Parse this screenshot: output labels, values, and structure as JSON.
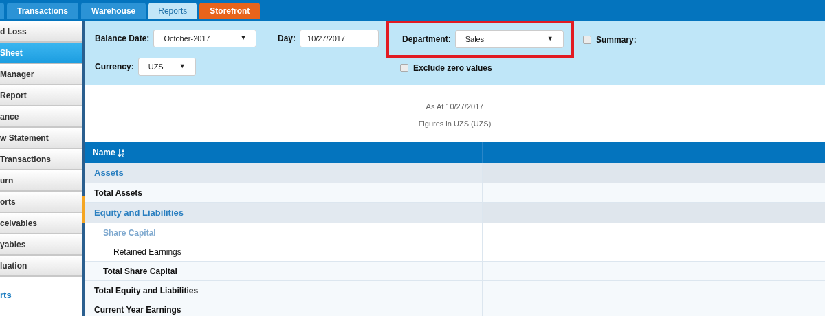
{
  "tabs": [
    {
      "label": "Transactions",
      "kind": "tab",
      "selected": false
    },
    {
      "label": "Warehouse",
      "kind": "tab",
      "selected": false
    },
    {
      "label": "Reports",
      "kind": "tab",
      "selected": true
    },
    {
      "label": "Storefront",
      "kind": "store",
      "selected": false
    }
  ],
  "sidebar": {
    "items": [
      {
        "label": "d Loss",
        "selected": false
      },
      {
        "label": "Sheet",
        "selected": true
      },
      {
        "label": "Manager",
        "selected": false
      },
      {
        "label": "Report",
        "selected": false
      },
      {
        "label": "ance",
        "selected": false
      },
      {
        "label": "w Statement",
        "selected": false
      },
      {
        "label": "Transactions",
        "selected": false
      },
      {
        "label": "urn",
        "selected": false
      },
      {
        "label": "orts",
        "selected": false
      },
      {
        "label": "ceivables",
        "selected": false
      },
      {
        "label": "yables",
        "selected": false
      },
      {
        "label": "luation",
        "selected": false
      }
    ],
    "link": "rts"
  },
  "filters": {
    "balance_date": {
      "label": "Balance Date:",
      "value": "October-2017",
      "arrow": "▼"
    },
    "day": {
      "label": "Day:",
      "value": "10/27/2017"
    },
    "department": {
      "label": "Department:",
      "value": "Sales",
      "arrow": "▼",
      "highlighted": true
    },
    "summary": {
      "label": "Summary:",
      "checked": false
    },
    "currency": {
      "label": "Currency:",
      "value": "UZS",
      "arrow": "▼"
    },
    "exclude_zero": {
      "label": "Exclude zero values",
      "checked": false
    }
  },
  "report_header": [
    "As At 10/27/2017",
    "Figures in UZS (UZS)"
  ],
  "table": {
    "columns": [
      "Name"
    ],
    "rows": [
      {
        "kind": "section",
        "label": "Assets"
      },
      {
        "kind": "total",
        "label": "Total Assets"
      },
      {
        "kind": "section",
        "label": "Equity and Liabilities",
        "children": [
          {
            "kind": "group",
            "label": "Share Capital",
            "children": [
              {
                "kind": "account",
                "label": "Retained Earnings"
              }
            ]
          },
          {
            "kind": "total",
            "label": "Total Share Capital"
          }
        ]
      },
      {
        "kind": "total",
        "label": "Total Equity and Liabilities"
      },
      {
        "kind": "total",
        "label": "Current Year Earnings"
      }
    ]
  }
}
